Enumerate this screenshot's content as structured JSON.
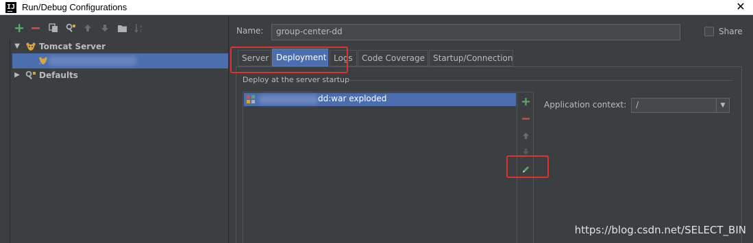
{
  "window": {
    "title": "Run/Debug Configurations",
    "app_icon_label": "IJ",
    "close_glyph": "✕"
  },
  "toolbar": {
    "icons": [
      "add-icon",
      "remove-icon",
      "copy-icon",
      "edit-defaults-icon",
      "move-up-icon",
      "move-down-icon",
      "folder-icon",
      "sort-icon"
    ]
  },
  "tree": {
    "tomcat_group": {
      "label": "Tomcat Server",
      "expanded": true,
      "icon": "tomcat-icon"
    },
    "selected_item": {
      "icon": "tomcat-config-icon"
    },
    "defaults": {
      "label": "Defaults",
      "expanded": false,
      "icon": "wrench-icon"
    }
  },
  "name_field": {
    "label": "Name:",
    "value": "group-center-dd"
  },
  "share": {
    "label": "Share",
    "checked": false
  },
  "tabs": {
    "items": [
      {
        "label": "Server",
        "active": false
      },
      {
        "label": "Deployment",
        "active": true
      },
      {
        "label": "Logs",
        "active": false
      },
      {
        "label": "Code Coverage",
        "active": false
      },
      {
        "label": "Startup/Connection",
        "active": false
      }
    ]
  },
  "deployment": {
    "section_title": "Deploy at the server startup",
    "artifact": {
      "label": "dd:war exploded",
      "icon": "artifact-icon"
    },
    "side_buttons": [
      "add-icon",
      "remove-icon",
      "move-up-icon",
      "move-down-icon",
      "edit-pencil-icon"
    ],
    "app_context": {
      "label": "Application context:",
      "value": "/"
    }
  },
  "watermark": "https://blog.csdn.net/SELECT_BIN",
  "colors": {
    "background": "#3c3f41",
    "selection": "#4b6eaf",
    "highlight_box": "#e0312b",
    "add_green": "#59a869",
    "remove_red": "#c75450"
  }
}
